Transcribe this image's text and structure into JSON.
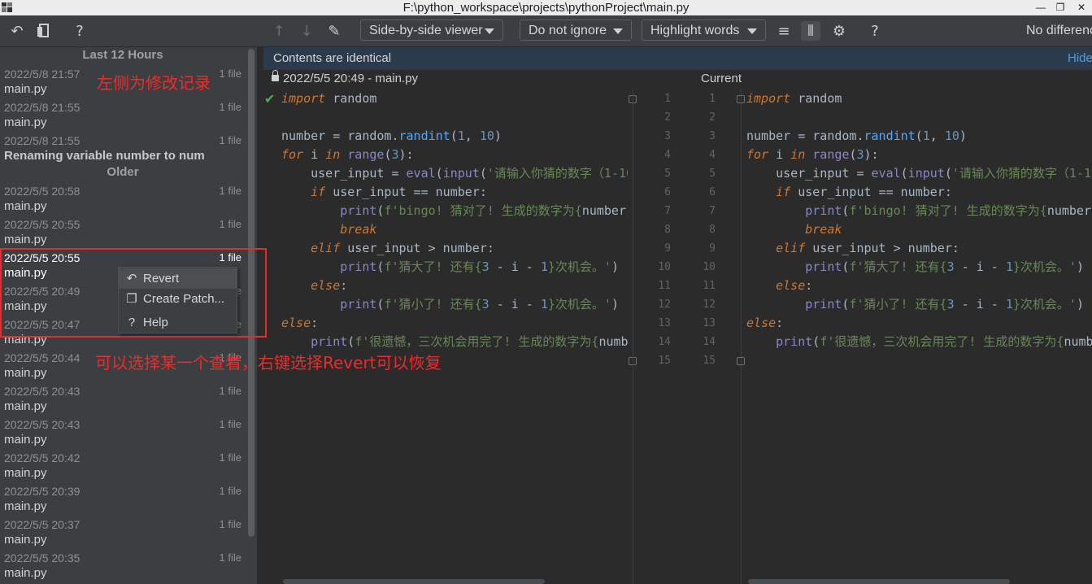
{
  "window": {
    "title": "F:\\python_workspace\\projects\\pythonProject\\main.py"
  },
  "toolbar": {
    "viewer_label": "Side-by-side viewer",
    "ignore_label": "Do not ignore",
    "highlight_label": "Highlight words",
    "status_text": "No differenc"
  },
  "history": {
    "group_recent": "Last 12 Hours",
    "group_older": "Older",
    "entries": [
      {
        "date": "2022/5/8 21:57",
        "count": "1 file",
        "name": "main.py"
      },
      {
        "date": "2022/5/8 21:55",
        "count": "1 file",
        "name": "main.py"
      },
      {
        "date": "2022/5/8 21:55",
        "count": "1 file",
        "name": "Renaming variable number to num"
      },
      {
        "date": "2022/5/5 20:58",
        "count": "1 file",
        "name": "main.py"
      },
      {
        "date": "2022/5/5 20:55",
        "count": "1 file",
        "name": "main.py"
      },
      {
        "date": "2022/5/5 20:55",
        "count": "1 file",
        "name": "main.py"
      },
      {
        "date": "2022/5/5 20:49",
        "count": "1 file",
        "name": "main.py"
      },
      {
        "date": "2022/5/5 20:47",
        "count": "1 file",
        "name": "main.py"
      },
      {
        "date": "2022/5/5 20:44",
        "count": "1 file",
        "name": "main.py"
      },
      {
        "date": "2022/5/5 20:43",
        "count": "1 file",
        "name": "main.py"
      },
      {
        "date": "2022/5/5 20:43",
        "count": "1 file",
        "name": "main.py"
      },
      {
        "date": "2022/5/5 20:42",
        "count": "1 file",
        "name": "main.py"
      },
      {
        "date": "2022/5/5 20:39",
        "count": "1 file",
        "name": "main.py"
      },
      {
        "date": "2022/5/5 20:37",
        "count": "1 file",
        "name": "main.py"
      },
      {
        "date": "2022/5/5 20:35",
        "count": "1 file",
        "name": "main.py"
      }
    ]
  },
  "context_menu": {
    "revert": "Revert",
    "create_patch": "Create Patch...",
    "help": "Help"
  },
  "diff": {
    "banner": "Contents are identical",
    "hide_link": "Hide",
    "left_title": "2022/5/5 20:49 - main.py",
    "right_title": "Current",
    "line_numbers": [
      "1",
      "2",
      "3",
      "4",
      "5",
      "6",
      "7",
      "8",
      "9",
      "10",
      "11",
      "12",
      "13",
      "14",
      "15"
    ]
  },
  "annotations": {
    "left_note": "左侧为修改记录",
    "bottom_note": "可以选择某一个查看，右键选择Revert可以恢复"
  }
}
